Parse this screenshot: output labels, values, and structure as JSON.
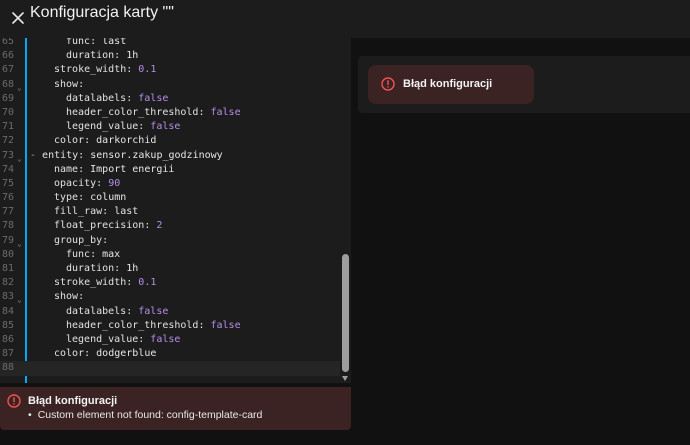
{
  "header": {
    "title": "Konfiguracja karty \"\""
  },
  "editor": {
    "lines": [
      {
        "n": "65",
        "fold": false,
        "indent": 3,
        "key": "func",
        "value": "last",
        "type": "v"
      },
      {
        "n": "66",
        "fold": false,
        "indent": 3,
        "key": "duration",
        "value": "1h",
        "type": "v"
      },
      {
        "n": "67",
        "fold": false,
        "indent": 2,
        "key": "stroke_width",
        "value": "0.1",
        "type": "n"
      },
      {
        "n": "68",
        "fold": true,
        "indent": 2,
        "key": "show",
        "value": "",
        "type": "v"
      },
      {
        "n": "69",
        "fold": false,
        "indent": 3,
        "key": "datalabels",
        "value": "false",
        "type": "n"
      },
      {
        "n": "70",
        "fold": false,
        "indent": 3,
        "key": "header_color_threshold",
        "value": "false",
        "type": "n"
      },
      {
        "n": "71",
        "fold": false,
        "indent": 3,
        "key": "legend_value",
        "value": "false",
        "type": "n"
      },
      {
        "n": "72",
        "fold": false,
        "indent": 2,
        "key": "color",
        "value": "darkorchid",
        "type": "v"
      },
      {
        "n": "73",
        "fold": true,
        "indent": 1,
        "dash": true,
        "key": "entity",
        "value": "sensor.zakup_godzinowy",
        "type": "v"
      },
      {
        "n": "74",
        "fold": false,
        "indent": 2,
        "key": "name",
        "value": "Import energii",
        "type": "v"
      },
      {
        "n": "75",
        "fold": false,
        "indent": 2,
        "key": "opacity",
        "value": "90",
        "type": "n"
      },
      {
        "n": "76",
        "fold": false,
        "indent": 2,
        "key": "type",
        "value": "column",
        "type": "v"
      },
      {
        "n": "77",
        "fold": false,
        "indent": 2,
        "key": "fill_raw",
        "value": "last",
        "type": "v"
      },
      {
        "n": "78",
        "fold": false,
        "indent": 2,
        "key": "float_precision",
        "value": "2",
        "type": "n"
      },
      {
        "n": "79",
        "fold": true,
        "indent": 2,
        "key": "group_by",
        "value": "",
        "type": "v"
      },
      {
        "n": "80",
        "fold": false,
        "indent": 3,
        "key": "func",
        "value": "max",
        "type": "v"
      },
      {
        "n": "81",
        "fold": false,
        "indent": 3,
        "key": "duration",
        "value": "1h",
        "type": "v"
      },
      {
        "n": "82",
        "fold": false,
        "indent": 2,
        "key": "stroke_width",
        "value": "0.1",
        "type": "n"
      },
      {
        "n": "83",
        "fold": true,
        "indent": 2,
        "key": "show",
        "value": "",
        "type": "v"
      },
      {
        "n": "84",
        "fold": false,
        "indent": 3,
        "key": "datalabels",
        "value": "false",
        "type": "n"
      },
      {
        "n": "85",
        "fold": false,
        "indent": 3,
        "key": "header_color_threshold",
        "value": "false",
        "type": "n"
      },
      {
        "n": "86",
        "fold": false,
        "indent": 3,
        "key": "legend_value",
        "value": "false",
        "type": "n"
      },
      {
        "n": "87",
        "fold": false,
        "indent": 2,
        "key": "color",
        "value": "dodgerblue",
        "type": "v"
      },
      {
        "n": "88",
        "fold": false,
        "indent": 0,
        "key": "",
        "value": "",
        "type": "v",
        "active": true
      }
    ]
  },
  "editor_error": {
    "title": "Błąd konfiguracji",
    "items": [
      "Custom element not found: config-template-card"
    ]
  },
  "preview": {
    "error_title": "Błąd konfiguracji"
  },
  "colors": {
    "accent": "#03a9f4",
    "error_bg": "#3b2323",
    "error_icon": "#ef5350",
    "number_literal": "#b58ee8"
  }
}
